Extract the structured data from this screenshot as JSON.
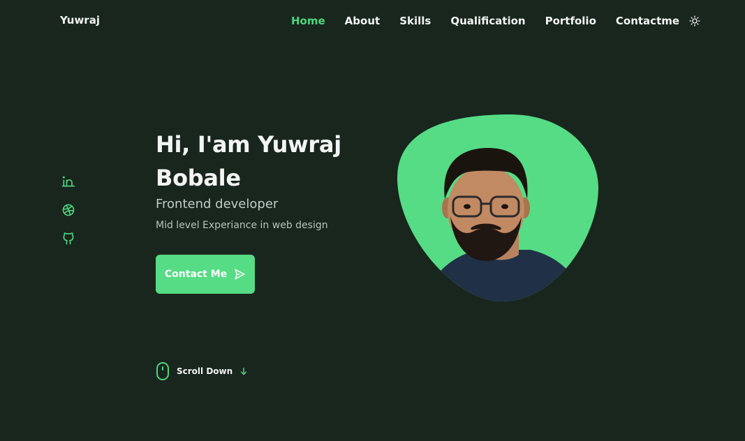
{
  "header": {
    "logo": "Yuwraj",
    "nav": [
      {
        "label": "Home",
        "active": true
      },
      {
        "label": "About",
        "active": false
      },
      {
        "label": "Skills",
        "active": false
      },
      {
        "label": "Qualification",
        "active": false
      },
      {
        "label": "Portfolio",
        "active": false
      },
      {
        "label": "Contactme",
        "active": false
      }
    ],
    "theme_toggle_icon": "sun-icon"
  },
  "social": [
    {
      "icon": "linkedin-icon"
    },
    {
      "icon": "dribbble-icon"
    },
    {
      "icon": "github-icon"
    }
  ],
  "hero": {
    "title_line1": "Hi, I'am Yuwraj",
    "title_line2": "Bobale",
    "subtitle": "Frontend developer",
    "description": "Mid level Experiance in web design",
    "cta_label": "Contact Me",
    "cta_icon": "send-icon",
    "image_icon": "profile-photo"
  },
  "scroll": {
    "label": "Scroll Down",
    "mouse_icon": "mouse-icon",
    "arrow_icon": "arrow-down-icon"
  },
  "colors": {
    "background": "#18261e",
    "accent": "#4fd67f",
    "text": "#f2f5f3",
    "button": "#55dc85"
  }
}
